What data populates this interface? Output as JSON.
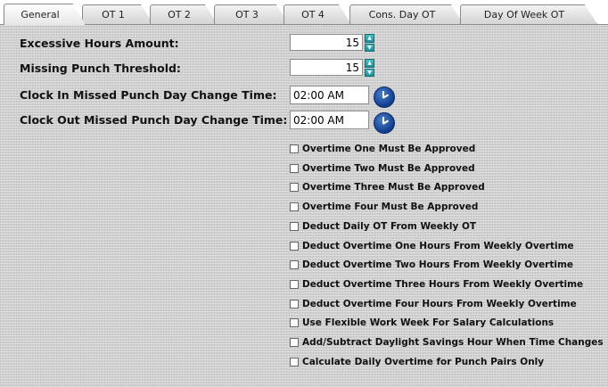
{
  "tabs": [
    {
      "label": "General"
    },
    {
      "label": "OT 1"
    },
    {
      "label": "OT 2"
    },
    {
      "label": "OT 3"
    },
    {
      "label": "OT 4"
    },
    {
      "label": "Cons. Day OT"
    },
    {
      "label": "Day Of Week OT"
    }
  ],
  "fields": {
    "excessive_hours": {
      "label": "Excessive Hours Amount:",
      "value": "15"
    },
    "missing_punch": {
      "label": "Missing Punch Threshold:",
      "value": "15"
    },
    "clock_in_change": {
      "label": "Clock In Missed Punch Day Change Time:",
      "value": "02:00 AM"
    },
    "clock_out_change": {
      "label": "Clock Out Missed Punch Day Change Time:",
      "value": "02:00 AM"
    }
  },
  "checkboxes": [
    {
      "label": "Overtime One Must Be Approved",
      "checked": false
    },
    {
      "label": "Overtime Two Must Be Approved",
      "checked": false
    },
    {
      "label": "Overtime Three Must Be Approved",
      "checked": false
    },
    {
      "label": "Overtime Four Must Be Approved",
      "checked": false
    },
    {
      "label": "Deduct Daily OT From Weekly OT",
      "checked": false
    },
    {
      "label": "Deduct Overtime One Hours From Weekly Overtime",
      "checked": false
    },
    {
      "label": "Deduct Overtime Two Hours From Weekly Overtime",
      "checked": false
    },
    {
      "label": "Deduct Overtime Three Hours From Weekly Overtime",
      "checked": false
    },
    {
      "label": "Deduct Overtime Four Hours From Weekly Overtime",
      "checked": false
    },
    {
      "label": "Use Flexible Work Week For Salary Calculations",
      "checked": false
    },
    {
      "label": "Add/Subtract Daylight Savings Hour When Time Changes",
      "checked": false
    },
    {
      "label": "Calculate Daily Overtime for Punch Pairs Only",
      "checked": false
    }
  ],
  "active_tab": "General"
}
